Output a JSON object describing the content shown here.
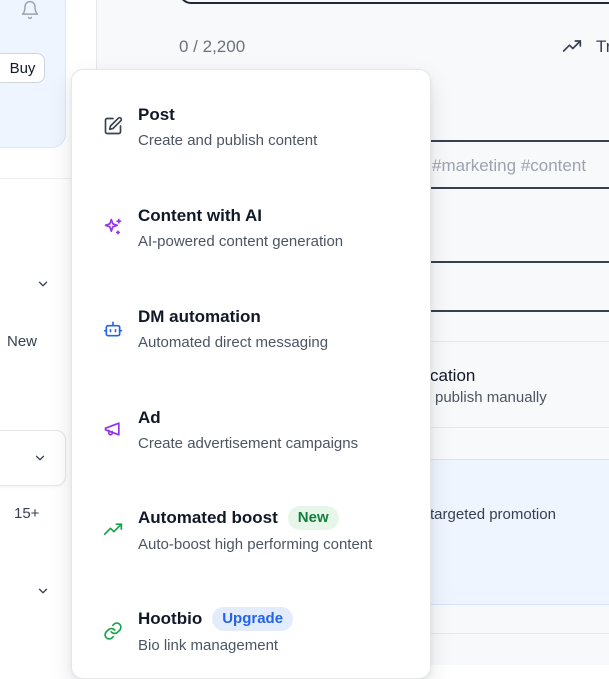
{
  "sidebar": {
    "buy_label": "Buy",
    "new_label": "New",
    "count_label": "15+"
  },
  "main": {
    "char_count": "0 / 2,200",
    "trend_label_partial": "Tr",
    "hashtags_placeholder": "#marketing #content",
    "option_title_partial": "cation",
    "option_desc_partial": "publish manually",
    "boost_desc_partial": "targeted promotion"
  },
  "dropdown": {
    "items": [
      {
        "title": "Post",
        "description": "Create and publish content",
        "icon": "edit-icon",
        "badge": ""
      },
      {
        "title": "Content with AI",
        "description": "AI-powered content generation",
        "icon": "sparkles-icon",
        "badge": ""
      },
      {
        "title": "DM automation",
        "description": "Automated direct messaging",
        "icon": "bot-icon",
        "badge": ""
      },
      {
        "title": "Ad",
        "description": "Create advertisement campaigns",
        "icon": "megaphone-icon",
        "badge": ""
      },
      {
        "title": "Automated boost",
        "description": "Auto-boost high performing content",
        "icon": "trending-up-icon",
        "badge": "New"
      },
      {
        "title": "Hootbio",
        "description": "Bio link management",
        "icon": "link-icon",
        "badge": "Upgrade"
      }
    ]
  },
  "colors": {
    "accent_blue": "#2563eb",
    "ai_purple": "#9333ea",
    "boost_green": "#16a34a",
    "sidebar_card_bg": "#eef5ff"
  }
}
